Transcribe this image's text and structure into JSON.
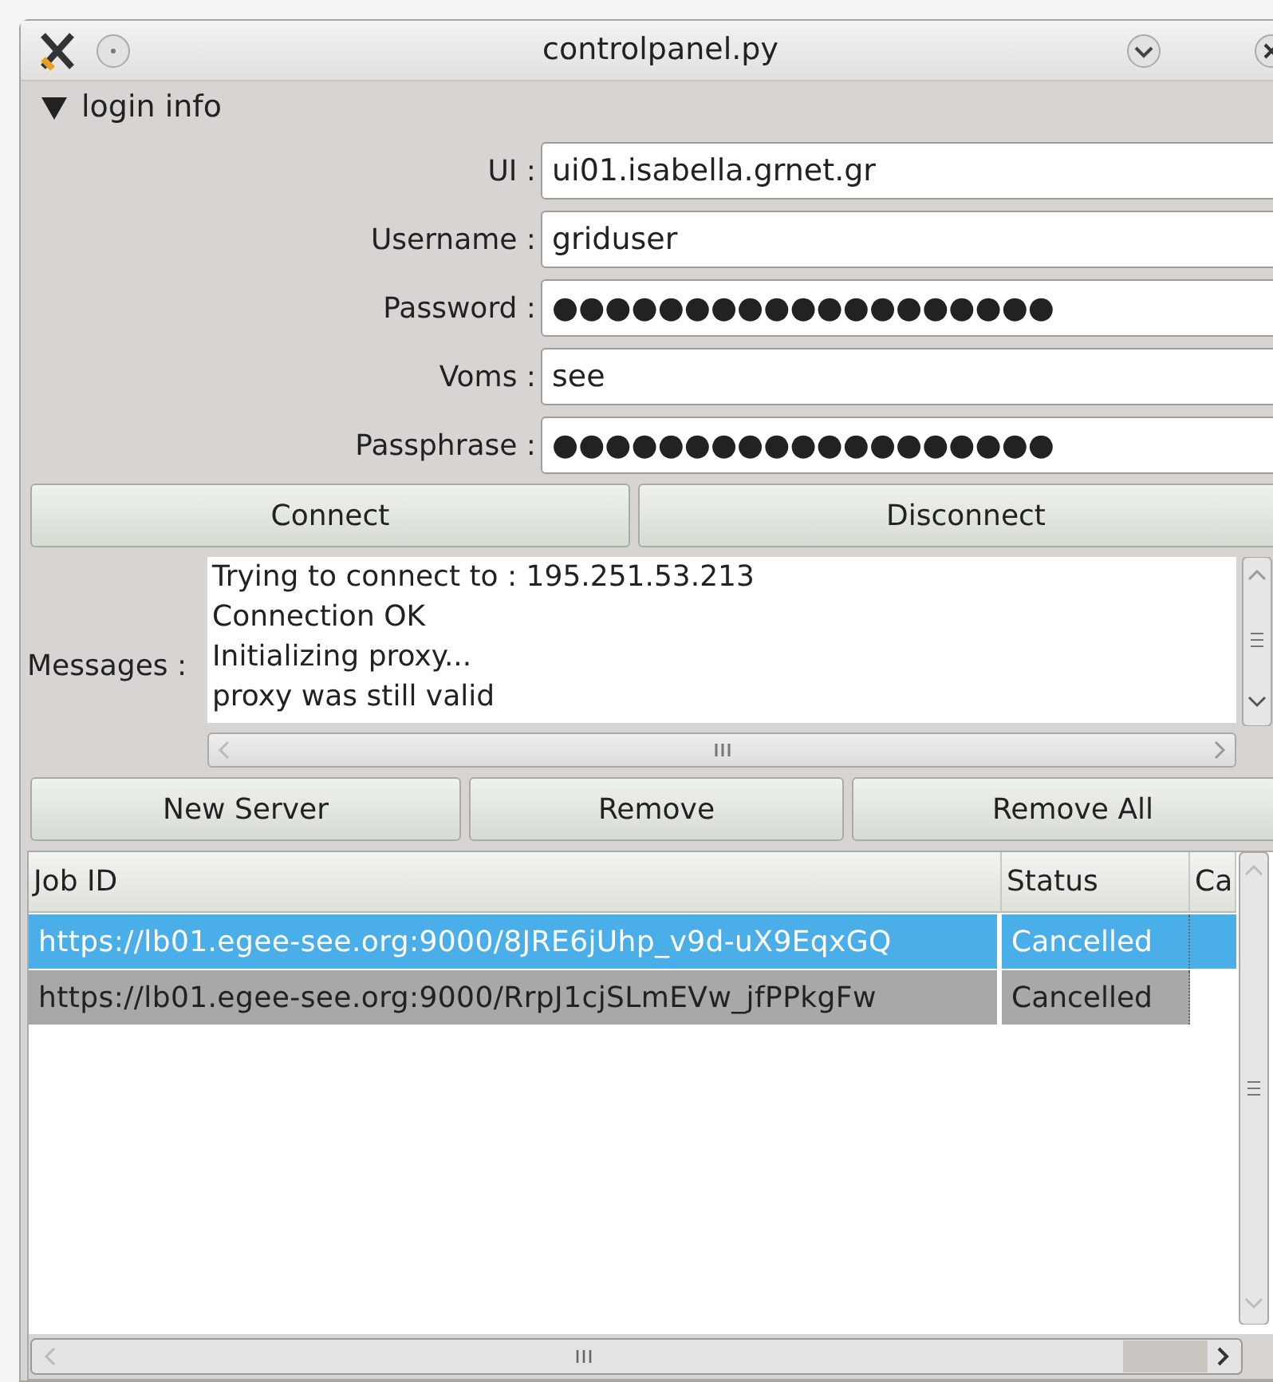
{
  "window": {
    "title": "controlpanel.py"
  },
  "login_section": {
    "label": "login info",
    "expanded": true
  },
  "fields": [
    {
      "label": "UI :",
      "value": "ui01.isabella.grnet.gr"
    },
    {
      "label": "Username :",
      "value": "griduser"
    },
    {
      "label": "Password :",
      "value": "●●●●●●●●●●●●●●●●●●●"
    },
    {
      "label": "Voms :",
      "value": "see"
    },
    {
      "label": "Passphrase :",
      "value": "●●●●●●●●●●●●●●●●●●●"
    }
  ],
  "connection_buttons": [
    "Connect",
    "Disconnect"
  ],
  "messages": {
    "label": "Messages :",
    "lines": [
      "Trying to connect to : 195.251.53.213",
      "Connection OK",
      "Initializing proxy...",
      "proxy was still valid"
    ]
  },
  "server_buttons": [
    "New Server",
    "Remove",
    "Remove All"
  ],
  "table": {
    "columns": [
      "Job ID",
      "Status",
      "Ca"
    ],
    "rows": [
      {
        "cells": [
          "https://lb01.egee-see.org:9000/8JRE6jUhp_v9d-uX9EqxGQ",
          "Cancelled"
        ],
        "selected": true
      },
      {
        "cells": [
          "https://lb01.egee-see.org:9000/RrpJ1cjSLmEVw_jfPPkgFw",
          "Cancelled"
        ],
        "selected": false
      }
    ]
  }
}
